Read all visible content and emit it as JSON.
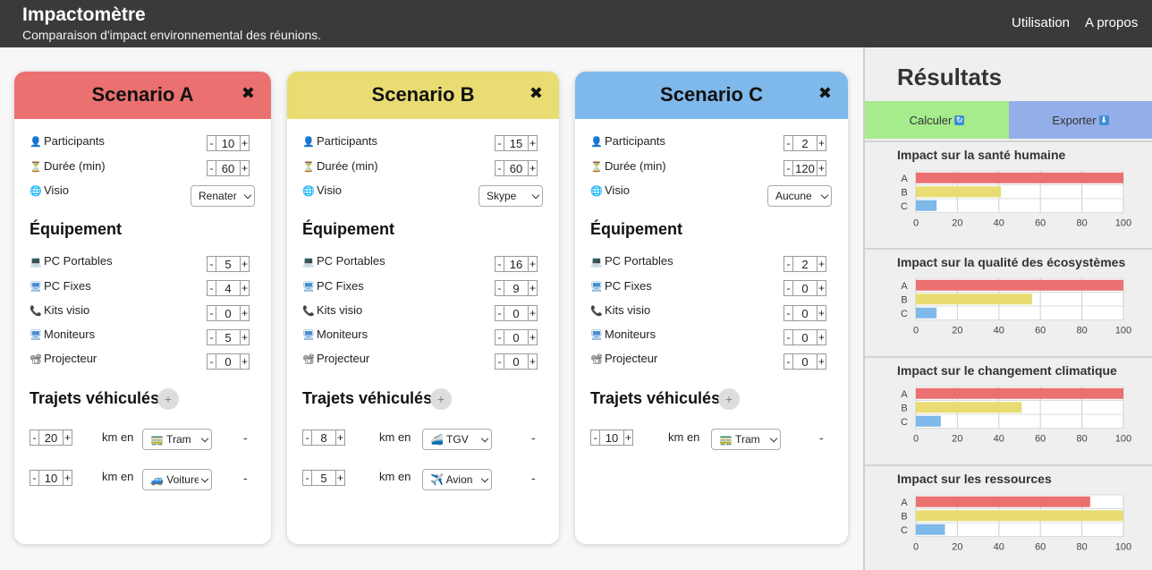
{
  "app": {
    "title": "Impactomètre",
    "subtitle": "Comparaison d'impact environnemental des réunions."
  },
  "nav": [
    {
      "label": "Utilisation"
    },
    {
      "label": "A propos"
    }
  ],
  "close_symbol": "✖",
  "labels": {
    "participants": "Participants",
    "duree": "Durée (min)",
    "visio": "Visio",
    "equipement": "Équipement",
    "pc_portables": "PC Portables",
    "pc_fixes": "PC Fixes",
    "kits_visio": "Kits visio",
    "moniteurs": "Moniteurs",
    "projecteur": "Projecteur",
    "trajets": "Trajets véhiculés",
    "km_en": "km en",
    "minus": "-",
    "plus": "+",
    "add": "+",
    "remove": "-"
  },
  "icons": {
    "participants": "person-icon",
    "duree": "hourglass-icon",
    "visio": "globe-icon",
    "pc_portables": "laptop-icon",
    "pc_fixes": "desktop-icon",
    "kits_visio": "phone-icon",
    "moniteurs": "monitor-icon",
    "projecteur": "projector-icon"
  },
  "scenarios": [
    {
      "name": "Scenario A",
      "color": "#eb7070",
      "participants": "10",
      "duree": "60",
      "visio": "Renater",
      "pc_portables": "5",
      "pc_fixes": "4",
      "kits_visio": "0",
      "moniteurs": "5",
      "projecteur": "0",
      "trajets": [
        {
          "km": "20",
          "mode": "🚃 Tram"
        },
        {
          "km": "10",
          "mode": "🚙 Voiture"
        }
      ]
    },
    {
      "name": "Scenario B",
      "color": "#e8dc72",
      "participants": "15",
      "duree": "60",
      "visio": "Skype",
      "pc_portables": "16",
      "pc_fixes": "9",
      "kits_visio": "0",
      "moniteurs": "0",
      "projecteur": "0",
      "trajets": [
        {
          "km": "8",
          "mode": "🚄 TGV"
        },
        {
          "km": "5",
          "mode": "✈️ Avion"
        }
      ]
    },
    {
      "name": "Scenario C",
      "color": "#7fb8ea",
      "participants": "2",
      "duree": "120",
      "visio": "Aucune",
      "pc_portables": "2",
      "pc_fixes": "0",
      "kits_visio": "0",
      "moniteurs": "0",
      "projecteur": "0",
      "trajets": [
        {
          "km": "10",
          "mode": "🚃 Tram"
        }
      ]
    }
  ],
  "results": {
    "title": "Résultats",
    "calculer": {
      "label": "Calculer",
      "icon": "refresh-icon",
      "color": "#a6eb8c"
    },
    "exporter": {
      "label": "Exporter",
      "icon": "download-icon",
      "color": "#93aee8"
    }
  },
  "chart_data": [
    {
      "type": "bar",
      "orientation": "horizontal",
      "title": "Impact sur la santé humaine",
      "categories": [
        "A",
        "B",
        "C"
      ],
      "values": [
        100,
        41,
        10
      ],
      "colors": [
        "#eb7070",
        "#e8dc72",
        "#7fb8ea"
      ],
      "xlim": [
        0,
        100
      ],
      "xticks": [
        0,
        20,
        40,
        60,
        80,
        100
      ],
      "grid": true
    },
    {
      "type": "bar",
      "orientation": "horizontal",
      "title": "Impact sur la qualité des écosystèmes",
      "categories": [
        "A",
        "B",
        "C"
      ],
      "values": [
        100,
        56,
        10
      ],
      "colors": [
        "#eb7070",
        "#e8dc72",
        "#7fb8ea"
      ],
      "xlim": [
        0,
        100
      ],
      "xticks": [
        0,
        20,
        40,
        60,
        80,
        100
      ],
      "grid": true
    },
    {
      "type": "bar",
      "orientation": "horizontal",
      "title": "Impact sur le changement climatique",
      "categories": [
        "A",
        "B",
        "C"
      ],
      "values": [
        100,
        51,
        12
      ],
      "colors": [
        "#eb7070",
        "#e8dc72",
        "#7fb8ea"
      ],
      "xlim": [
        0,
        100
      ],
      "xticks": [
        0,
        20,
        40,
        60,
        80,
        100
      ],
      "grid": true
    },
    {
      "type": "bar",
      "orientation": "horizontal",
      "title": "Impact sur les ressources",
      "categories": [
        "A",
        "B",
        "C"
      ],
      "values": [
        84,
        100,
        14
      ],
      "colors": [
        "#eb7070",
        "#e8dc72",
        "#7fb8ea"
      ],
      "xlim": [
        0,
        100
      ],
      "xticks": [
        0,
        20,
        40,
        60,
        80,
        100
      ],
      "grid": true
    }
  ]
}
